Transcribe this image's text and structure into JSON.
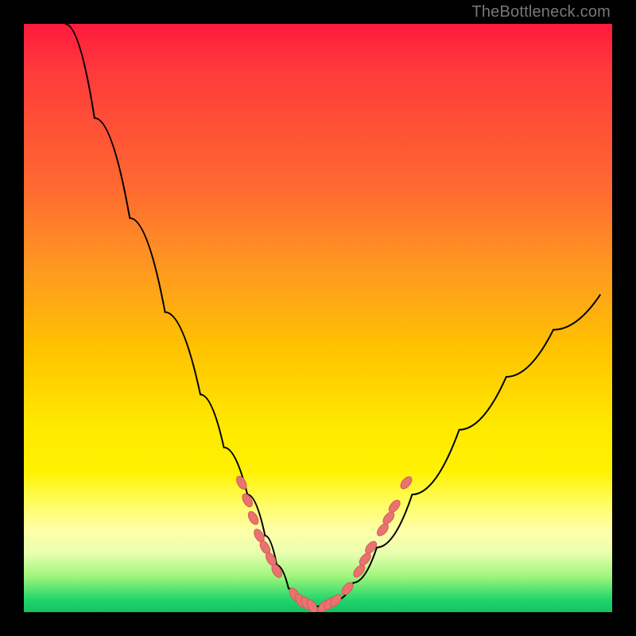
{
  "watermark": "TheBottleneck.com",
  "colors": {
    "frame": "#000000",
    "gradient_stops": [
      "#ff1a3c",
      "#ff6a30",
      "#ffc200",
      "#fff200",
      "#9cf57a",
      "#18c060"
    ],
    "curve": "#000000",
    "dots": "#e77471"
  },
  "chart_data": {
    "type": "line",
    "title": "",
    "xlabel": "",
    "ylabel": "",
    "xlim": [
      0,
      100
    ],
    "ylim": [
      0,
      100
    ],
    "grid": false,
    "legend": false,
    "note": "V-shaped bottleneck curve. Axes are normalized 0–100 (left/bottom origin). y = mismatch/bottleneck percentage (0 at green bottom, 100 at red top). Values estimated from pixel positions.",
    "series": [
      {
        "name": "bottleneck-curve",
        "x": [
          7,
          12,
          18,
          24,
          30,
          34,
          38,
          41,
          43,
          45,
          47,
          49,
          51,
          53,
          56,
          60,
          66,
          74,
          82,
          90,
          98
        ],
        "y": [
          100,
          84,
          67,
          51,
          37,
          28,
          20,
          13,
          8,
          4,
          2,
          1,
          1,
          2,
          5,
          11,
          20,
          31,
          40,
          48,
          54
        ]
      }
    ],
    "markers": {
      "name": "highlighted-points",
      "note": "Salmon elongated dots clustered near the curve's valley on both flanks.",
      "points": [
        {
          "x": 37,
          "y": 22
        },
        {
          "x": 38,
          "y": 19
        },
        {
          "x": 39,
          "y": 16
        },
        {
          "x": 40,
          "y": 13
        },
        {
          "x": 41,
          "y": 11
        },
        {
          "x": 42,
          "y": 9
        },
        {
          "x": 43,
          "y": 7
        },
        {
          "x": 46,
          "y": 3
        },
        {
          "x": 47,
          "y": 2
        },
        {
          "x": 48,
          "y": 1.5
        },
        {
          "x": 49,
          "y": 1
        },
        {
          "x": 51,
          "y": 1
        },
        {
          "x": 52,
          "y": 1.5
        },
        {
          "x": 53,
          "y": 2
        },
        {
          "x": 55,
          "y": 4
        },
        {
          "x": 57,
          "y": 7
        },
        {
          "x": 58,
          "y": 9
        },
        {
          "x": 59,
          "y": 11
        },
        {
          "x": 61,
          "y": 14
        },
        {
          "x": 62,
          "y": 16
        },
        {
          "x": 63,
          "y": 18
        },
        {
          "x": 65,
          "y": 22
        }
      ]
    }
  }
}
